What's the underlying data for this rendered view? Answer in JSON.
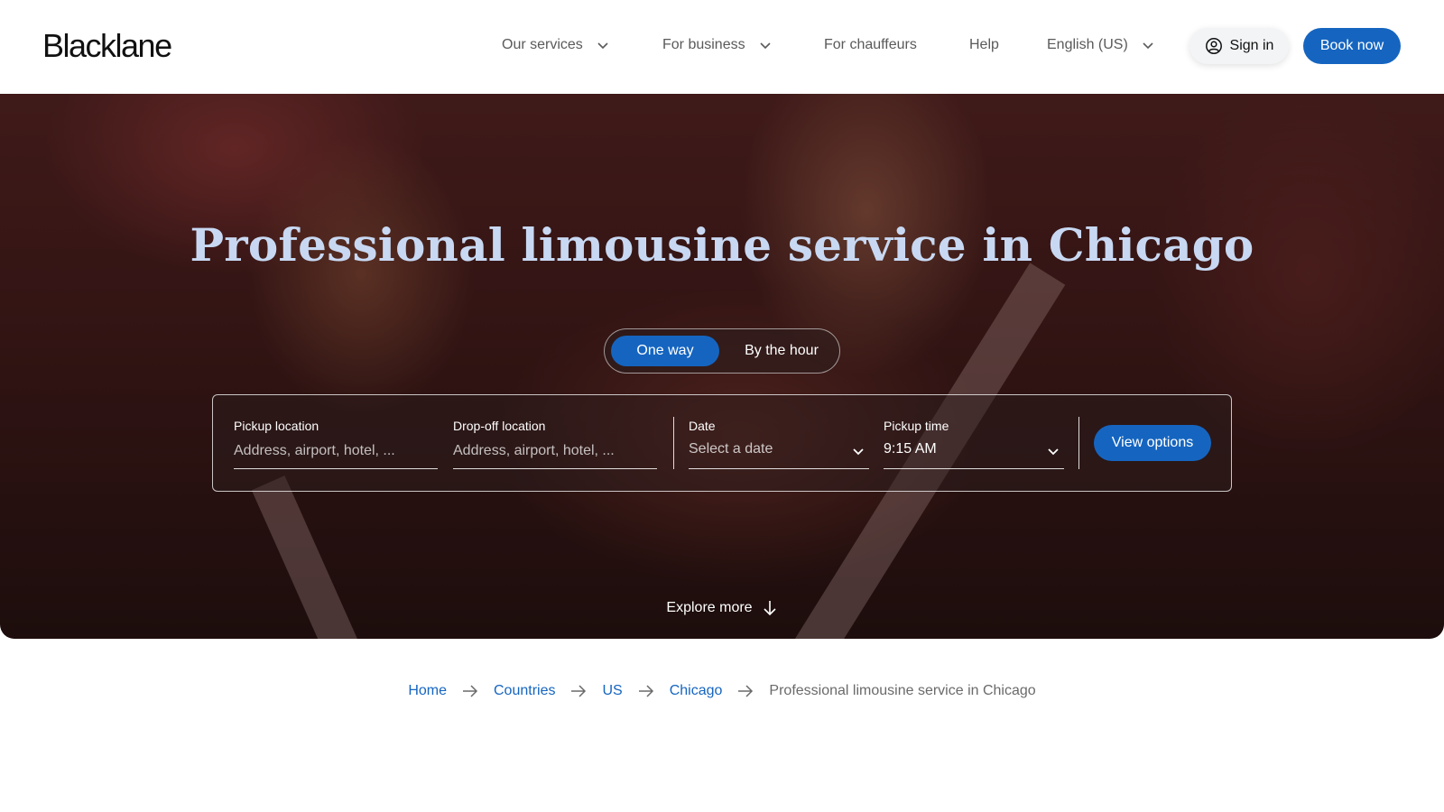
{
  "header": {
    "logo": "Blacklane",
    "nav": [
      {
        "label": "Our services",
        "has_dropdown": true
      },
      {
        "label": "For business",
        "has_dropdown": true
      },
      {
        "label": "For chauffeurs",
        "has_dropdown": false
      },
      {
        "label": "Help",
        "has_dropdown": false
      },
      {
        "label": "English (US)",
        "has_dropdown": true
      }
    ],
    "sign_in_label": "Sign in",
    "book_now_label": "Book now",
    "accent_color": "#1565c0"
  },
  "hero": {
    "title": "Professional limousine service in Chicago",
    "toggle": {
      "options": [
        "One way",
        "By the hour"
      ],
      "selected": "One way"
    },
    "form": {
      "pickup_label": "Pickup location",
      "pickup_placeholder": "Address, airport, hotel, ...",
      "dropoff_label": "Drop-off location",
      "dropoff_placeholder": "Address, airport, hotel, ...",
      "date_label": "Date",
      "date_value": "Select a date",
      "time_label": "Pickup time",
      "time_value": "9:15 AM",
      "submit_label": "View options"
    },
    "explore_label": "Explore more"
  },
  "breadcrumb": {
    "items": [
      "Home",
      "Countries",
      "US",
      "Chicago"
    ],
    "current": "Professional limousine service in Chicago"
  }
}
